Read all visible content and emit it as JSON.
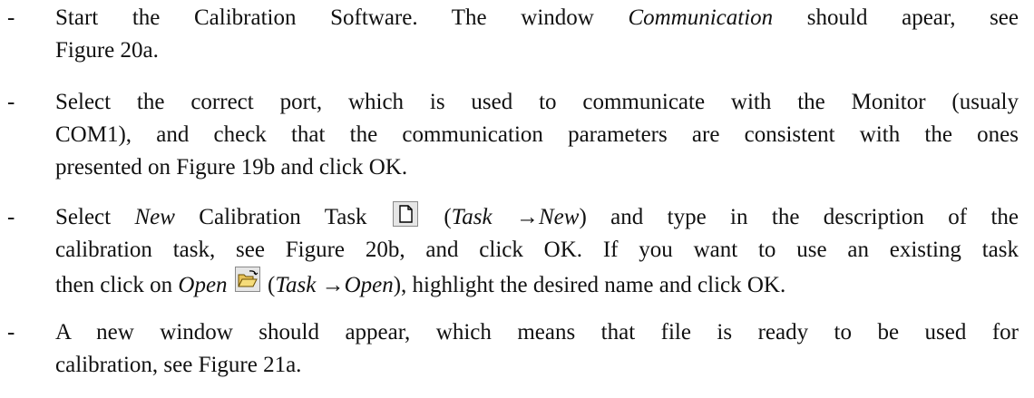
{
  "bullets": [
    {
      "dash": "-",
      "lines": [
        {
          "segments": [
            {
              "t": "Start the Calibration Software. The window "
            },
            {
              "t": "Communication",
              "i": true
            },
            {
              "t": " should apear, see"
            }
          ]
        },
        {
          "segments": [
            {
              "t": "Figure 20a."
            }
          ]
        }
      ]
    },
    {
      "dash": "-",
      "lines": [
        {
          "segments": [
            {
              "t": "Select the correct port, which is used to communicate with the Monitor (usualy"
            }
          ]
        },
        {
          "segments": [
            {
              "t": "COM1), and check that the communication parameters are consistent with the ones"
            }
          ]
        },
        {
          "segments": [
            {
              "t": "presented on Figure 19b and click OK."
            }
          ]
        }
      ]
    },
    {
      "dash": "-",
      "lines": [
        {
          "segments": [
            {
              "t": "Select "
            },
            {
              "t": "New",
              "i": true
            },
            {
              "t": " Calibration Task "
            },
            {
              "icon": "new-file-icon"
            },
            {
              "t": " ("
            },
            {
              "t": "Task",
              "i": true
            },
            {
              "t": " →"
            },
            {
              "t": "New",
              "i": true
            },
            {
              "t": ") and type in the description of the"
            }
          ]
        },
        {
          "segments": [
            {
              "t": "calibration task, see Figure 20b, and click OK. If you want to use an existing task"
            }
          ]
        },
        {
          "segments": [
            {
              "t": "then click on "
            },
            {
              "t": "Open",
              "i": true
            },
            {
              "t": " "
            },
            {
              "icon": "open-folder-icon"
            },
            {
              "t": " ("
            },
            {
              "t": "Task",
              "i": true
            },
            {
              "t": " →"
            },
            {
              "t": "Open",
              "i": true
            },
            {
              "t": "), highlight the desired name and click OK."
            }
          ]
        }
      ]
    },
    {
      "dash": "-",
      "lines": [
        {
          "segments": [
            {
              "t": "A new window should appear, which means that file is ready to be used for"
            }
          ]
        },
        {
          "segments": [
            {
              "t": "calibration, see Figure 21a."
            }
          ]
        }
      ]
    }
  ]
}
